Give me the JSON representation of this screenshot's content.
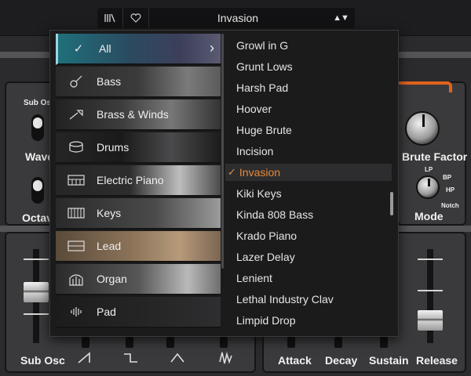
{
  "preset_bar": {
    "browser_icon": "library-icon",
    "favorite_icon": "heart-icon",
    "preset_name": "Invasion",
    "nav_arrows": "▲▼"
  },
  "synth": {
    "sub_osc_label": "Sub Osc",
    "wave_label": "Wave",
    "octave_label": "Octave",
    "brute_factor_label": "Brute Factor",
    "mode_label": "Mode",
    "filter_modes": [
      "LP",
      "BP",
      "HP",
      "Notch"
    ],
    "bottom_labels": {
      "sub_osc": "Sub Osc",
      "attack": "Attack",
      "decay": "Decay",
      "sustain": "Sustain",
      "release": "Release"
    },
    "wave_shapes": [
      "saw",
      "square",
      "triangle",
      "noise"
    ],
    "accent_color": "#e0641e"
  },
  "categories": [
    {
      "label": "All",
      "icon": "check-icon",
      "selected": true
    },
    {
      "label": "Bass",
      "icon": "bass-guitar-icon"
    },
    {
      "label": "Brass & Winds",
      "icon": "trumpet-icon"
    },
    {
      "label": "Drums",
      "icon": "drum-icon"
    },
    {
      "label": "Electric Piano",
      "icon": "electric-piano-icon"
    },
    {
      "label": "Keys",
      "icon": "keys-icon"
    },
    {
      "label": "Lead",
      "icon": "lead-icon"
    },
    {
      "label": "Organ",
      "icon": "organ-icon"
    },
    {
      "label": "Pad",
      "icon": "pad-waveform-icon"
    }
  ],
  "presets": [
    {
      "name": "Growl in G"
    },
    {
      "name": "Grunt Lows"
    },
    {
      "name": "Harsh Pad"
    },
    {
      "name": "Hoover"
    },
    {
      "name": "Huge Brute"
    },
    {
      "name": "Incision"
    },
    {
      "name": "Invasion",
      "selected": true
    },
    {
      "name": "Kiki Keys"
    },
    {
      "name": "Kinda 808 Bass"
    },
    {
      "name": "Krado Piano"
    },
    {
      "name": "Lazer Delay"
    },
    {
      "name": "Lenient"
    },
    {
      "name": "Lethal Industry Clav"
    },
    {
      "name": "Limpid Drop"
    }
  ],
  "selected_preset_color": "#e78a3a"
}
